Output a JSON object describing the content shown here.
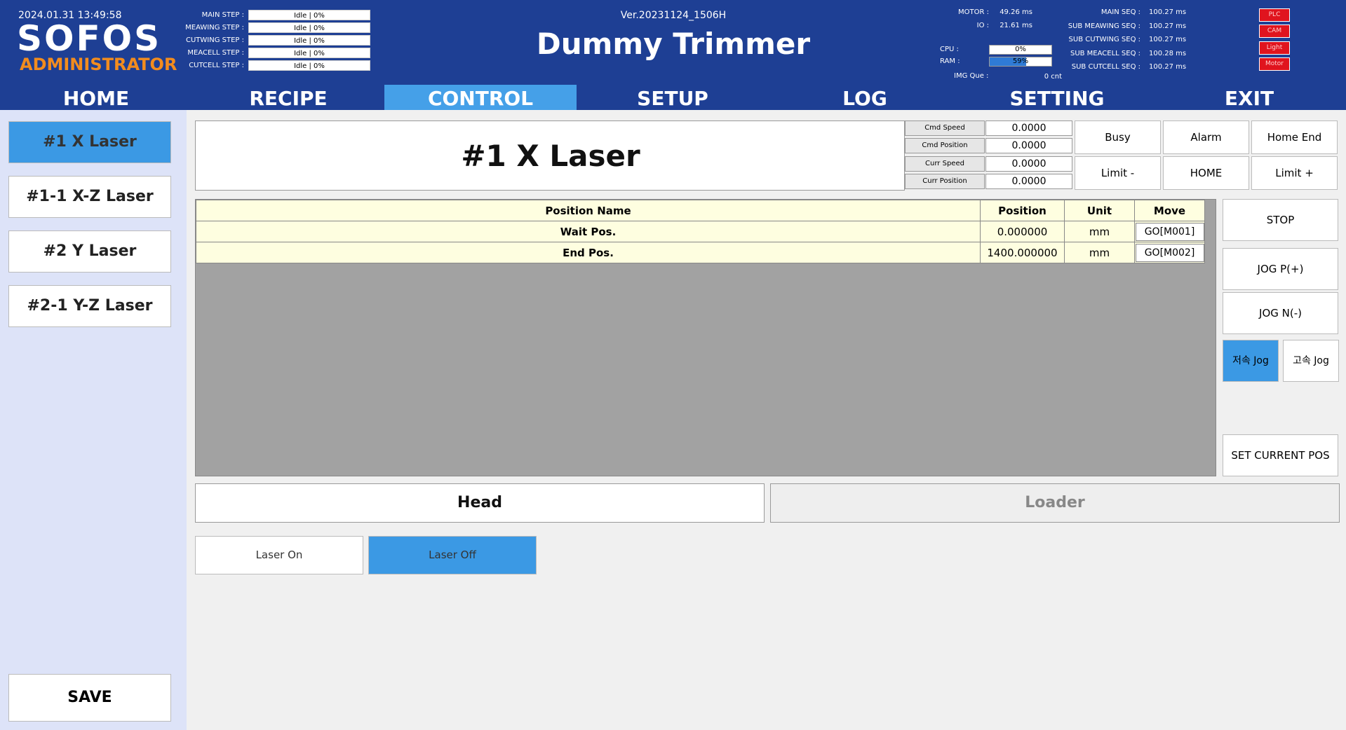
{
  "header": {
    "datetime": "2024.01.31 13:49:58",
    "logo": "SOFOS",
    "role": "ADMINISTRATOR",
    "version": "Ver.20231124_1506H",
    "title": "Dummy Trimmer",
    "steps": [
      {
        "label": "MAIN STEP :",
        "value": "Idle | 0%"
      },
      {
        "label": "MEAWING STEP :",
        "value": "Idle | 0%"
      },
      {
        "label": "CUTWING STEP :",
        "value": "Idle | 0%"
      },
      {
        "label": "MEACELL STEP :",
        "value": "Idle | 0%"
      },
      {
        "label": "CUTCELL STEP :",
        "value": "Idle | 0%"
      }
    ],
    "motor": {
      "label": "MOTOR :",
      "value": "49.26 ms"
    },
    "io": {
      "label": "IO :",
      "value": "21.61 ms"
    },
    "cpu": {
      "label": "CPU :",
      "value": "0%",
      "percent": 0
    },
    "ram": {
      "label": "RAM :",
      "value": "59%",
      "percent": 59
    },
    "img_que": {
      "label": "IMG Que :",
      "value": "0 cnt"
    },
    "seqs": [
      {
        "label": "MAIN SEQ :",
        "value": "100.27 ms"
      },
      {
        "label": "SUB MEAWING SEQ :",
        "value": "100.27 ms"
      },
      {
        "label": "SUB CUTWING SEQ :",
        "value": "100.27 ms"
      },
      {
        "label": "SUB MEACELL SEQ :",
        "value": "100.28 ms"
      },
      {
        "label": "SUB CUTCELL SEQ :",
        "value": "100.27 ms"
      }
    ],
    "indicators": [
      "PLC",
      "CAM",
      "Light",
      "Motor"
    ],
    "indicator_color": "#e0141e"
  },
  "nav": [
    {
      "label": "HOME",
      "active": false
    },
    {
      "label": "RECIPE",
      "active": false
    },
    {
      "label": "CONTROL",
      "active": true
    },
    {
      "label": "SETUP",
      "active": false
    },
    {
      "label": "LOG",
      "active": false
    },
    {
      "label": "SETTING",
      "active": false
    },
    {
      "label": "EXIT",
      "active": false
    }
  ],
  "sidebar": {
    "items": [
      {
        "label": "#1 X Laser",
        "active": true
      },
      {
        "label": "#1-1 X-Z Laser",
        "active": false
      },
      {
        "label": "#2 Y Laser",
        "active": false
      },
      {
        "label": "#2-1 Y-Z Laser",
        "active": false
      }
    ],
    "save_label": "SAVE"
  },
  "axis": {
    "title": "#1 X Laser",
    "info": [
      {
        "label": "Cmd Speed",
        "value": "0.0000"
      },
      {
        "label": "Cmd Position",
        "value": "0.0000"
      },
      {
        "label": "Curr Speed",
        "value": "0.0000"
      },
      {
        "label": "Curr Position",
        "value": "0.0000"
      }
    ],
    "status_buttons": [
      "Busy",
      "Alarm",
      "Home End",
      "Limit -",
      "HOME",
      "Limit +"
    ]
  },
  "positions": {
    "headers": [
      "Position Name",
      "Position",
      "Unit",
      "Move"
    ],
    "rows": [
      {
        "name": "Wait Pos.",
        "position": "0.000000",
        "unit": "mm",
        "move": "GO[M001]"
      },
      {
        "name": "End Pos.",
        "position": "1400.000000",
        "unit": "mm",
        "move": "GO[M002]"
      }
    ]
  },
  "jog": {
    "stop": "STOP",
    "jog_p": "JOG P(+)",
    "jog_n": "JOG N(-)",
    "low_speed": "저속 Jog",
    "high_speed": "고속 Jog",
    "set_current": "SET CURRENT POS"
  },
  "tabs": {
    "head": "Head",
    "loader": "Loader"
  },
  "laser": {
    "on": "Laser On",
    "off": "Laser Off"
  },
  "colors": {
    "header_bg": "#1e3f94",
    "accent": "#45a0e8",
    "role": "#f28c1e",
    "table_row": "#fefee0"
  }
}
